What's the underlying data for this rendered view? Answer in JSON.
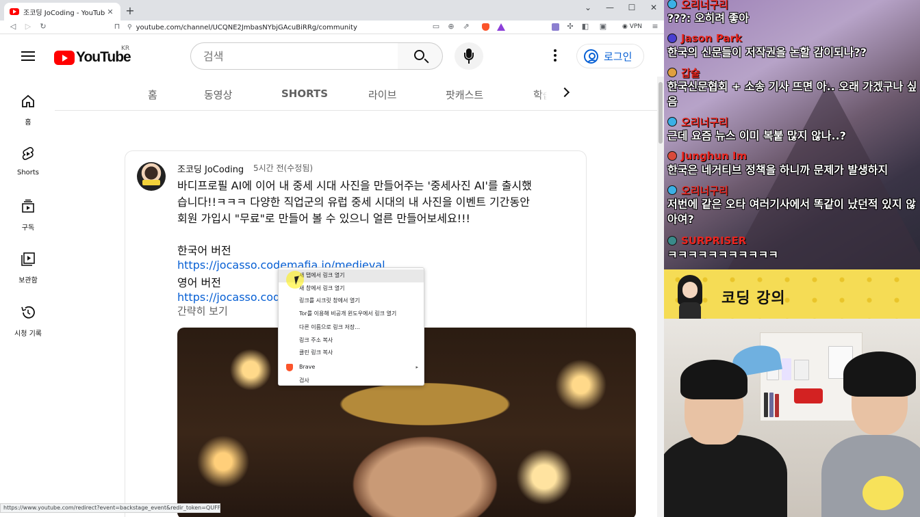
{
  "browser": {
    "tab_title": "조코딩 JoCoding - YouTube",
    "new_tab": "+",
    "window_controls": {
      "chevron": "⌄",
      "minimize": "—",
      "maximize": "☐",
      "close": "✕"
    },
    "url": "youtube.com/channel/UCQNE2JmbasNYbjGAcuBiRRg/community",
    "vpn_label": "VPN",
    "status_url": "https://www.youtube.com/redirect?event=backstage_event&redir_token=QUFFL..."
  },
  "youtube": {
    "logo_text": "YouTube",
    "region": "KR",
    "search_placeholder": "검색",
    "login_label": "로그인",
    "guide": [
      {
        "label": "홈",
        "icon": "home-icon"
      },
      {
        "label": "Shorts",
        "icon": "shorts-icon"
      },
      {
        "label": "구독",
        "icon": "subscriptions-icon"
      },
      {
        "label": "보관함",
        "icon": "library-icon"
      },
      {
        "label": "시청 기록",
        "icon": "history-icon"
      }
    ],
    "channel_tabs": [
      "홈",
      "동영상",
      "SHORTS",
      "라이브",
      "팟캐스트",
      "학습"
    ],
    "post": {
      "author": "조코딩 JoCoding",
      "time": "5시간 전(수정됨)",
      "body_lines": [
        "바디프로필 AI에 이어 내 중세 시대 사진을 만들어주는 '중세사진 AI'를 출시했",
        "습니다!!ㅋㅋㅋ 다양한 직업군의 유럽 중세 시대의 내 사진을 이벤트 기간동안",
        "회원 가입시 \"무료\"로 만들어 볼 수 있으니 얼른 만들어보세요!!!"
      ],
      "korean_label": "한국어 버전",
      "korean_link": "https://jocasso.codemafia.io/medieval",
      "english_label": "영어 버전",
      "english_link": "https://jocasso.codemafia.io/en/medieval",
      "read_less": "간략히 보기"
    }
  },
  "context_menu": {
    "items": [
      "새 탭에서 링크 열기",
      "새 창에서 링크 열기",
      "링크를 시크릿 창에서 열기",
      "Tor를 이용해 비공개 윈도우에서 링크 열기",
      "다른 이름으로 링크 저장...",
      "링크 주소 복사",
      "클린 링크 복사",
      "Brave",
      "검사"
    ],
    "submenu_arrow": "▸"
  },
  "stream": {
    "chat": [
      {
        "name": "오리너구리",
        "text": "???: 오히려 좋아",
        "badge_color": "#3bb0e6"
      },
      {
        "name": "Jason Park",
        "text": "한국의 신문들이 저작권을 논할 감이되나??",
        "badge_color": "#4a3fd0"
      },
      {
        "name": "갑술",
        "text": "한국신문협회 + 소송 기사 뜨면 아.. 오래 가겠구나 싶음",
        "badge_color": "#e0a040"
      },
      {
        "name": "오리너구리",
        "text": "근데 요즘 뉴스 이미 복붙 많지 않나..?",
        "badge_color": "#3bb0e6"
      },
      {
        "name": "Junghun Im",
        "text": "한국은 네거티브 정책을 하니까 문제가 발생하지",
        "badge_color": "#d94a3a"
      },
      {
        "name": "오리너구리",
        "text": "저번에 같은 오타 여러기사에서 똑같이 났던적 있지 않아여?",
        "badge_color": "#3bb0e6"
      },
      {
        "name": "SURPRISER",
        "text": "ㅋㅋㅋㅋㅋㅋㅋㅋㅋㅋㅋ",
        "badge_color": "#3a8a8a"
      }
    ],
    "banner_text": "코딩 강의"
  }
}
